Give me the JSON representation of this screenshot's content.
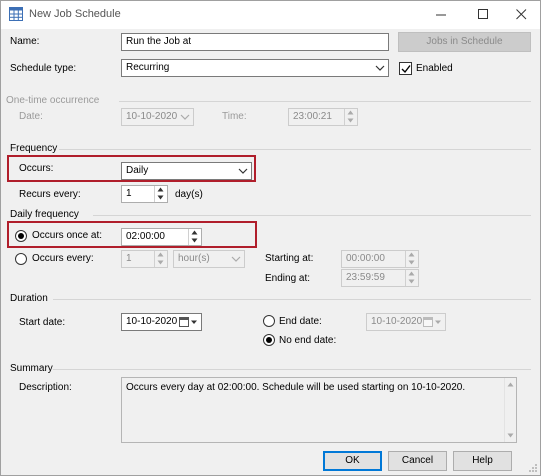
{
  "window": {
    "title": "New Job Schedule"
  },
  "form": {
    "name_label": "Name:",
    "name_value": "Run the Job at",
    "jobs_button": "Jobs in Schedule",
    "schedule_type_label": "Schedule type:",
    "schedule_type_value": "Recurring",
    "enabled_label": "Enabled",
    "enabled_checked": true
  },
  "one_time": {
    "section": "One-time occurrence",
    "date_label": "Date:",
    "date_value": "10-10-2020",
    "time_label": "Time:",
    "time_value": "23:00:21"
  },
  "frequency": {
    "section": "Frequency",
    "occurs_label": "Occurs:",
    "occurs_value": "Daily",
    "recurs_label": "Recurs every:",
    "recurs_value": "1",
    "recurs_unit": "day(s)"
  },
  "daily": {
    "section": "Daily frequency",
    "once_label": "Occurs once at:",
    "once_value": "02:00:00",
    "every_label": "Occurs every:",
    "every_value": "1",
    "every_unit": "hour(s)",
    "starting_label": "Starting at:",
    "starting_value": "00:00:00",
    "ending_label": "Ending at:",
    "ending_value": "23:59:59"
  },
  "duration": {
    "section": "Duration",
    "start_label": "Start date:",
    "start_value": "10-10-2020",
    "end_label": "End date:",
    "end_value": "10-10-2020",
    "no_end_label": "No end date:"
  },
  "summary": {
    "section": "Summary",
    "description_label": "Description:",
    "description_value": "Occurs every day at 02:00:00. Schedule will be used starting on 10-10-2020."
  },
  "buttons": {
    "ok": "OK",
    "cancel": "Cancel",
    "help": "Help"
  },
  "colors": {
    "highlight": "#b01e2b",
    "primary_border": "#0078d7"
  }
}
